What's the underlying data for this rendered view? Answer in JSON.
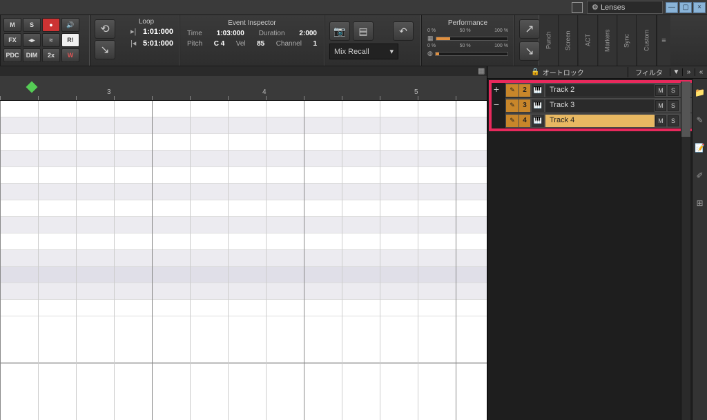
{
  "top": {
    "lenses": "Lenses"
  },
  "toolbar_btns": {
    "r1c1": "M",
    "r1c2": "S",
    "r1c3": "●",
    "r1c4": "🔊",
    "r2c1": "FX",
    "r2c2": "◂▸",
    "r2c3": "≈",
    "r2c4": "R!",
    "r3c1": "PDC",
    "r3c2": "DIM",
    "r3c3": "2x",
    "r3c4": "W"
  },
  "loop": {
    "header": "Loop",
    "start": "1:01:000",
    "end": "5:01:000"
  },
  "inspector": {
    "header": "Event Inspector",
    "time_lbl": "Time",
    "time_val": "1:03:000",
    "dur_lbl": "Duration",
    "dur_val": "2:000",
    "pitch_lbl": "Pitch",
    "pitch_val": "C 4",
    "vel_lbl": "Vel",
    "vel_val": "85",
    "chan_lbl": "Channel",
    "chan_val": "1"
  },
  "mix_recall": "Mix Recall",
  "perf": {
    "header": "Performance",
    "scale0": "0 %",
    "scale50": "50 %",
    "scale100": "100 %"
  },
  "side_tabs": {
    "punch": "Punch",
    "screen": "Screen",
    "act": "ACT",
    "markers": "Markers",
    "sync": "Sync",
    "custom": "Custom"
  },
  "right": {
    "lock": "オートロック",
    "filter": "フィルタ"
  },
  "tracks": [
    {
      "num": "2",
      "name": "Track 2",
      "m": "M",
      "s": "S",
      "selected": false
    },
    {
      "num": "3",
      "name": "Track 3",
      "m": "M",
      "s": "S",
      "selected": false
    },
    {
      "num": "4",
      "name": "Track 4",
      "m": "M",
      "s": "S",
      "selected": true
    }
  ],
  "ruler": {
    "marks": [
      "3",
      "4",
      "5"
    ]
  }
}
